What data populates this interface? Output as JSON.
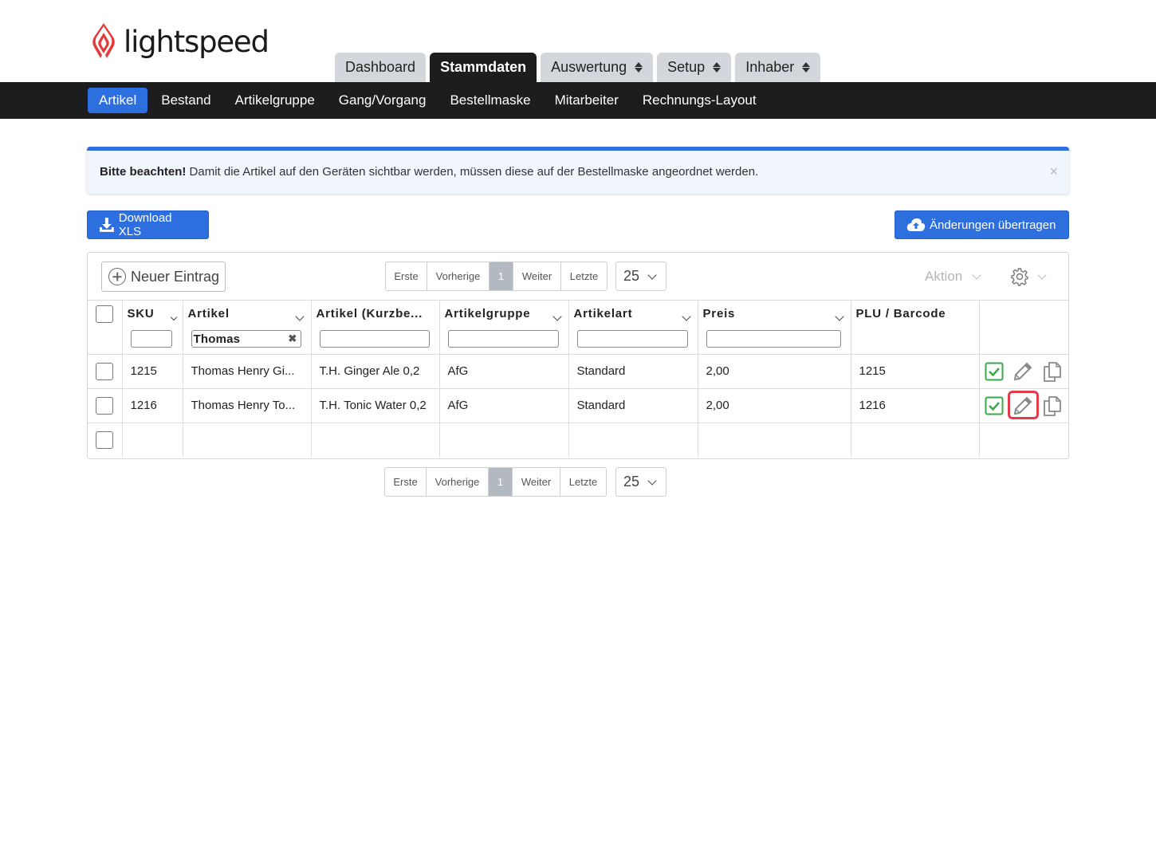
{
  "brand": {
    "name": "lightspeed",
    "color": "#e23c3c"
  },
  "main_tabs": [
    {
      "label": "Dashboard",
      "active": false,
      "dropdown": false
    },
    {
      "label": "Stammdaten",
      "active": true,
      "dropdown": false
    },
    {
      "label": "Auswertung",
      "active": false,
      "dropdown": true
    },
    {
      "label": "Setup",
      "active": false,
      "dropdown": true
    },
    {
      "label": "Inhaber",
      "active": false,
      "dropdown": true
    }
  ],
  "sub_nav": [
    {
      "label": "Artikel",
      "active": true
    },
    {
      "label": "Bestand",
      "active": false
    },
    {
      "label": "Artikelgruppe",
      "active": false
    },
    {
      "label": "Gang/Vorgang",
      "active": false
    },
    {
      "label": "Bestellmaske",
      "active": false
    },
    {
      "label": "Mitarbeiter",
      "active": false
    },
    {
      "label": "Rechnungs-Layout",
      "active": false
    }
  ],
  "alert": {
    "bold": "Bitte beachten!",
    "text": " Damit die Artikel auf den Geräten sichtbar werden, müssen diese auf der Bestellmaske angeordnet werden.",
    "close": "×"
  },
  "buttons": {
    "download": "Download XLS",
    "upload": "Änderungen übertragen",
    "new_entry": "Neuer Eintrag",
    "action": "Aktion"
  },
  "pager": {
    "first": "Erste",
    "prev": "Vorherige",
    "current": "1",
    "next": "Weiter",
    "last": "Letzte",
    "page_size": "25"
  },
  "columns": [
    {
      "label": "SKU",
      "filter": ""
    },
    {
      "label": "Artikel",
      "filter": "Thomas"
    },
    {
      "label": "Artikel (Kurzbe...",
      "filter": ""
    },
    {
      "label": "Artikelgruppe",
      "filter": ""
    },
    {
      "label": "Artikelart",
      "filter": ""
    },
    {
      "label": "Preis",
      "filter": ""
    },
    {
      "label": "PLU / Barcode",
      "filter": ""
    }
  ],
  "rows": [
    {
      "sku": "1215",
      "artikel": "Thomas Henry Gi...",
      "kurz": "T.H. Ginger Ale 0,2",
      "gruppe": "AfG",
      "art": "Standard",
      "preis": "2,00",
      "plu": "1215"
    },
    {
      "sku": "1216",
      "artikel": "Thomas Henry To...",
      "kurz": "T.H. Tonic Water 0,2",
      "gruppe": "AfG",
      "art": "Standard",
      "preis": "2,00",
      "plu": "1216"
    }
  ],
  "colors": {
    "accent": "#2e6fe0",
    "dark": "#1d1d1f",
    "active_check": "#3aa84a",
    "highlight": "#e03c4a"
  }
}
